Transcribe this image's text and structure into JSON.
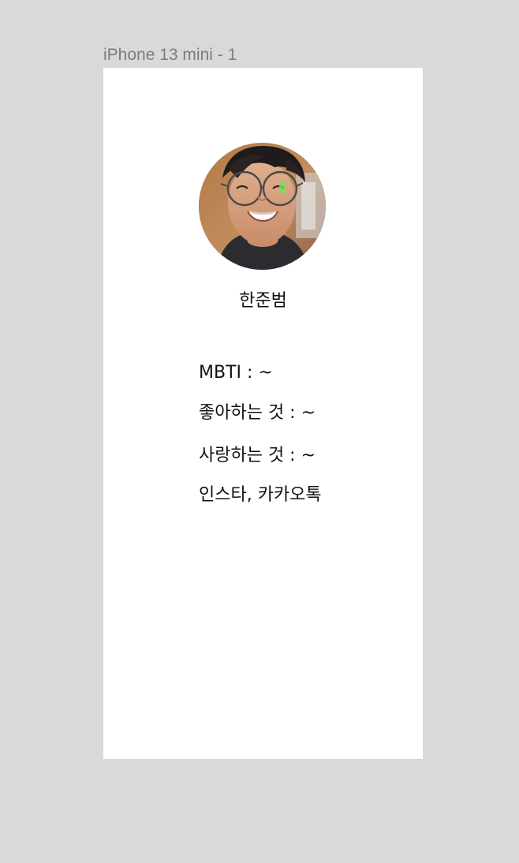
{
  "frame": {
    "label": "iPhone 13 mini - 1"
  },
  "profile": {
    "name": "한준범",
    "mbti": "MBTI : ~",
    "likes": "좋아하는 것 : ~",
    "loves": "사랑하는 것 : ~",
    "social": "인스타, 카카오톡"
  },
  "colors": {
    "canvas_background": "#d9d9d9",
    "frame_background": "#ffffff",
    "frame_label": "#7c7c7c",
    "text": "#111111"
  },
  "icons": {
    "avatar": "profile-photo"
  }
}
